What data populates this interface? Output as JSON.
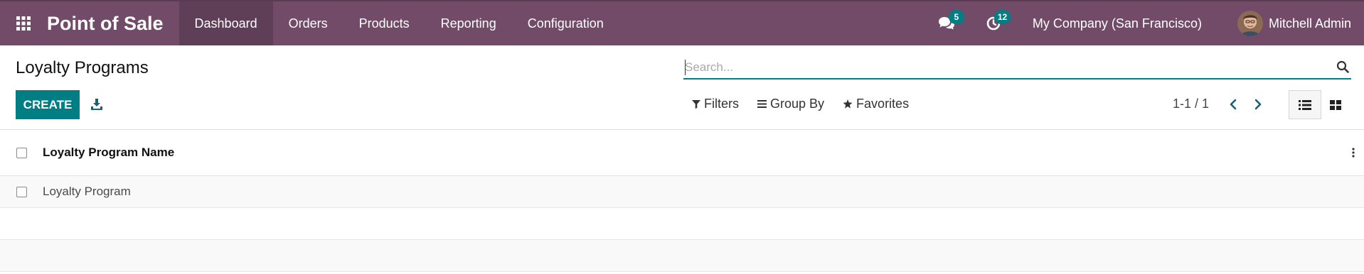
{
  "navbar": {
    "app_name": "Point of Sale",
    "menu": [
      {
        "label": "Dashboard",
        "active": true
      },
      {
        "label": "Orders"
      },
      {
        "label": "Products"
      },
      {
        "label": "Reporting"
      },
      {
        "label": "Configuration"
      }
    ],
    "messages_badge": "5",
    "activities_badge": "12",
    "company": "My Company (San Francisco)",
    "user_name": "Mitchell Admin",
    "icons": [
      "apps-grid-icon",
      "chat-icon",
      "clock-icon",
      "avatar"
    ]
  },
  "control_panel": {
    "title": "Loyalty Programs",
    "create_label": "CREATE",
    "search_placeholder": "Search...",
    "filters_label": "Filters",
    "group_by_label": "Group By",
    "favorites_label": "Favorites",
    "pager": "1-1 / 1"
  },
  "list": {
    "columns": [
      "Loyalty Program Name"
    ],
    "rows": [
      {
        "name": "Loyalty Program"
      }
    ]
  },
  "colors": {
    "navbar": "#714B67",
    "primary": "#017e84",
    "active_menu": "#5f3f57"
  }
}
